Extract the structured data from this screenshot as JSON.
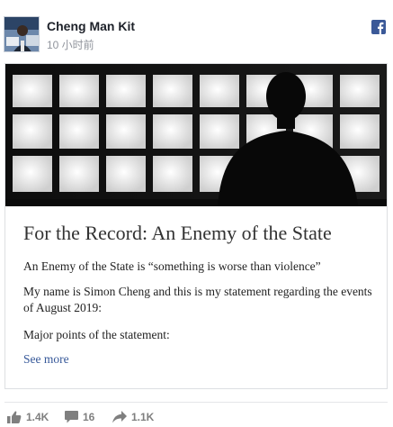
{
  "header": {
    "author": "Cheng Man Kit",
    "time": "10 小时前"
  },
  "card": {
    "title": "For the Record: An Enemy of the State",
    "paragraph_1": "An Enemy of the State is “something is worse than violence”",
    "paragraph_2": "My name is Simon Cheng and this is my statement regarding the events of August 2019:",
    "paragraph_3": "Major points of the statement:",
    "see_more": "See more"
  },
  "actions": {
    "likes": "1.4K",
    "comments": "16",
    "shares": "1.1K"
  },
  "colors": {
    "facebook_blue": "#3b5998",
    "link": "#365899",
    "muted": "#90949c"
  }
}
